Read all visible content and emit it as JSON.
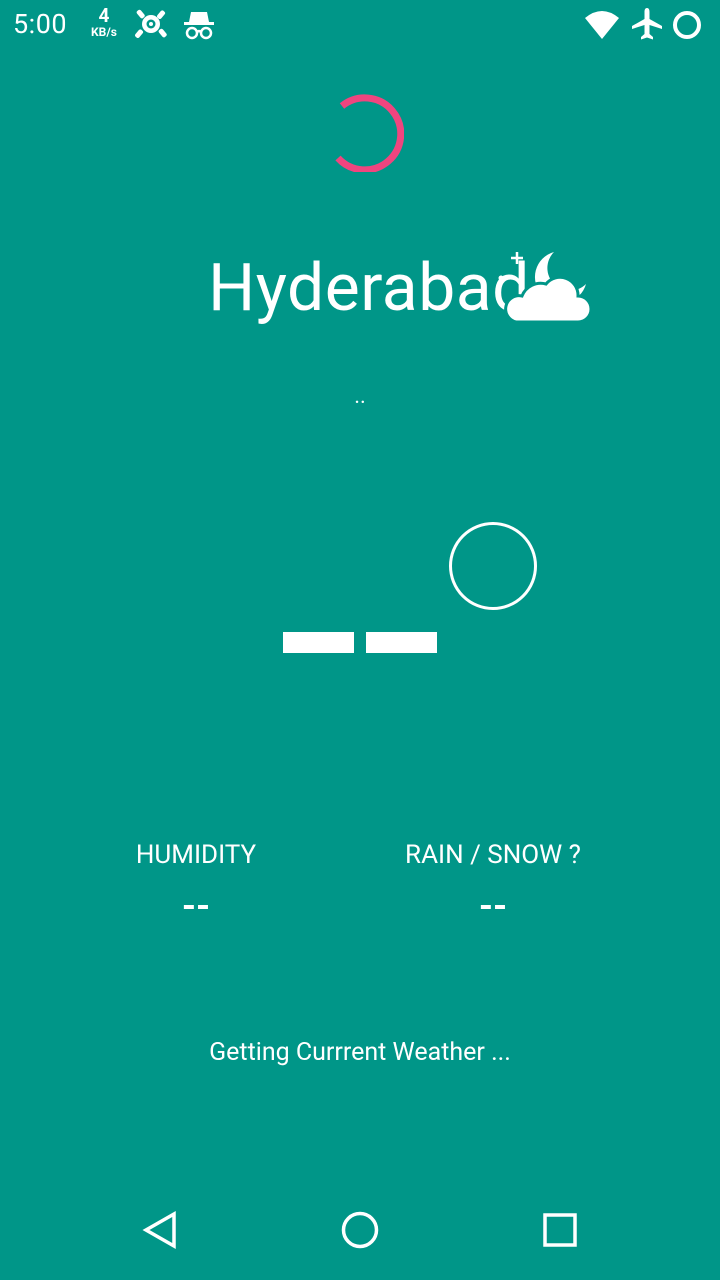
{
  "status_bar": {
    "time": "5:00",
    "net_speed_value": "4",
    "net_speed_unit": "KB/s",
    "icons": [
      "bug-icon",
      "incognito-icon",
      "wifi-icon",
      "airplane-mode-icon",
      "battery-loading-icon"
    ]
  },
  "weather": {
    "city": "Hyderabad",
    "condition_icon": "night-cloudy-icon",
    "description": "..",
    "temperature": "--",
    "humidity_label": "HUMIDITY",
    "humidity_value": "--",
    "precip_label": "RAIN / SNOW ?",
    "precip_value": "--",
    "status_message": "Getting Currrent Weather ..."
  },
  "colors": {
    "background": "#009688",
    "spinner_accent": "#F0457F",
    "foreground": "#FFFFFF"
  },
  "nav_bar": {
    "icons": [
      "back-icon",
      "home-icon",
      "recents-icon"
    ]
  }
}
